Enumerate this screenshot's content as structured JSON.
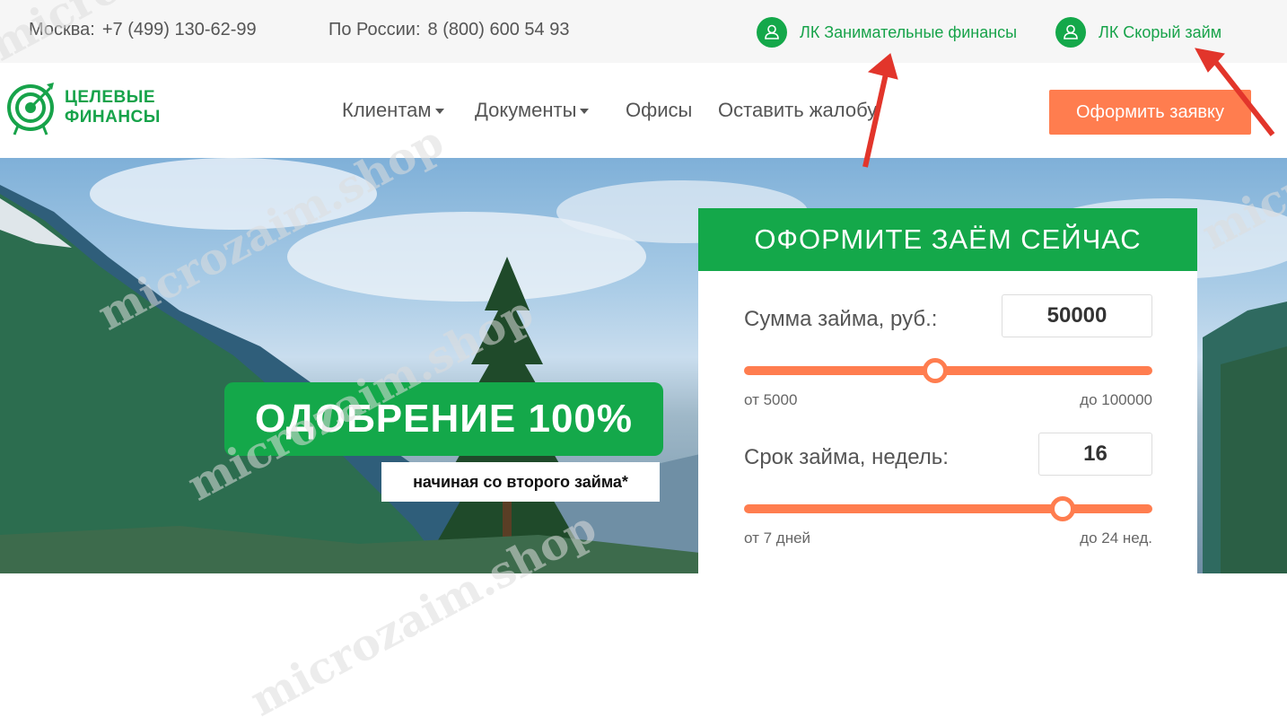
{
  "topbar": {
    "moscow_label": "Москва:",
    "moscow_phone": "+7 (499) 130-62-99",
    "russia_label": "По России:",
    "russia_phone": "8 (800) 600 54 93",
    "lk_links": [
      {
        "label": "ЛК Занимательные финансы",
        "icon": "user-icon"
      },
      {
        "label": "ЛК Скорый займ",
        "icon": "user-icon"
      }
    ]
  },
  "logo": {
    "line1": "ЦЕЛЕВЫЕ",
    "line2": "ФИНАНСЫ",
    "icon": "target-icon"
  },
  "nav": {
    "items": [
      {
        "label": "Клиентам",
        "dropdown": true
      },
      {
        "label": "Документы",
        "dropdown": true
      },
      {
        "label": "Офисы",
        "dropdown": false
      },
      {
        "label": "Оставить жалобу",
        "dropdown": false
      }
    ],
    "apply_button": "Оформить заявку"
  },
  "hero": {
    "approval": "ОДОБРЕНИЕ 100%",
    "approval_note": "начиная со второго займа*"
  },
  "loan_form": {
    "title": "ОФОРМИТЕ ЗАЁМ СЕЙЧАС",
    "amount": {
      "label": "Сумма займа, руб.:",
      "value": "50000",
      "min_label": "от 5000",
      "max_label": "до 100000",
      "min": 5000,
      "max": 100000,
      "current": 50000
    },
    "term": {
      "label": "Срок займа, недель:",
      "value": "16",
      "min_label": "от 7 дней",
      "max_label": "до 24 нед.",
      "current": 16
    }
  },
  "watermark": "microzaim.shop",
  "colors": {
    "brand_green": "#14a84a",
    "accent_orange": "#ff7d4f",
    "arrow_red": "#e2352b"
  }
}
